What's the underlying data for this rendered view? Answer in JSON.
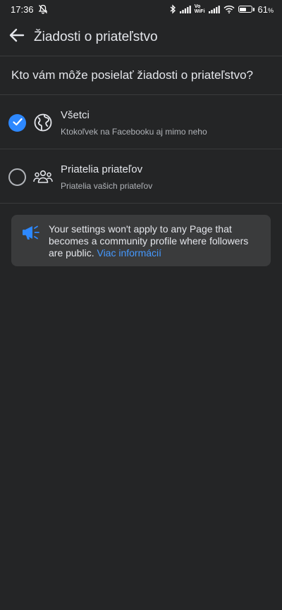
{
  "status_bar": {
    "time": "17:36",
    "battery_percent": "61",
    "battery_pct_sign": "%",
    "battery_level": 0.61,
    "vowifi_top": "Vo",
    "vowifi_bottom": "WiFi"
  },
  "header": {
    "title": "Žiadosti o priateľstvo"
  },
  "question": "Kto vám môže posielať žiadosti o priateľstvo?",
  "options": [
    {
      "title": "Všetci",
      "subtitle": "Ktokoľvek na Facebooku aj mimo neho",
      "selected": true,
      "icon": "globe-icon"
    },
    {
      "title": "Priatelia priateľov",
      "subtitle": "Priatelia vašich priateľov",
      "selected": false,
      "icon": "friends-icon"
    }
  ],
  "info": {
    "text": "Your settings won't apply to any Page that becomes a community profile where followers are public.",
    "link": "Viac informácií",
    "icon": "megaphone-icon"
  },
  "colors": {
    "background": "#242526",
    "accent": "#2d88ff",
    "link": "#4599ff",
    "card": "#3a3b3c"
  }
}
